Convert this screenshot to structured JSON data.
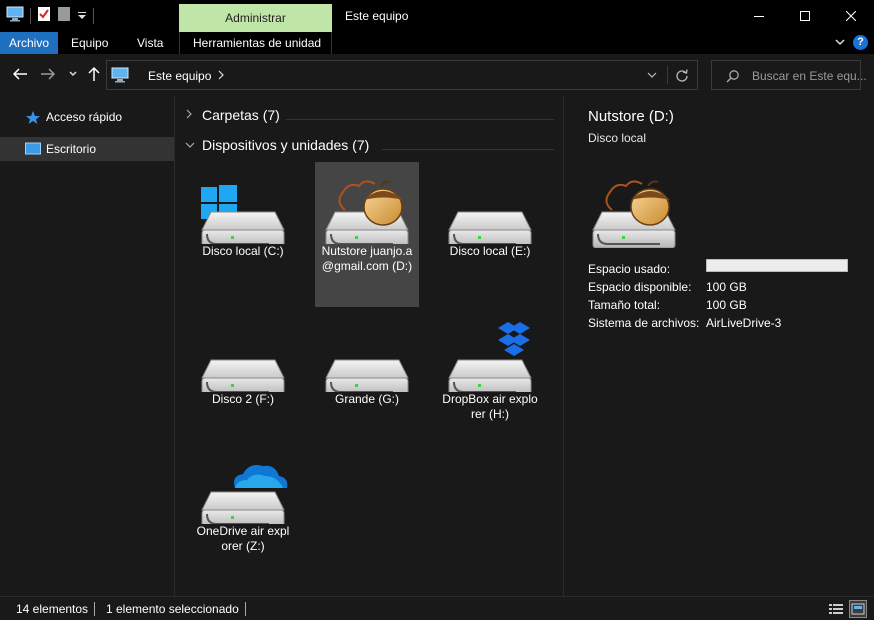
{
  "window": {
    "title": "Este equipo",
    "context_tab": "Administrar"
  },
  "ribbon": {
    "tabs": [
      "Archivo",
      "Equipo",
      "Vista"
    ],
    "context_tab_label": "Herramientas de unidad",
    "help": "?"
  },
  "address": {
    "breadcrumb": "Este equipo",
    "search_placeholder": "Buscar en Este equ..."
  },
  "sidebar": {
    "items": [
      {
        "label": "Acceso rápido",
        "icon": "star-icon"
      },
      {
        "label": "Escritorio",
        "icon": "desktop-icon"
      }
    ]
  },
  "groups": {
    "folders": {
      "label": "Carpetas (7)"
    },
    "devices": {
      "label": "Dispositivos y unidades (7)"
    }
  },
  "drives": [
    {
      "label": "Disco local (C:)",
      "icon": "windows-drive-icon"
    },
    {
      "label": "Nutstore juanjo.a@gmail.com (D:)",
      "icon": "nutstore-drive-icon",
      "selected": true
    },
    {
      "label": "Disco local (E:)",
      "icon": "drive-icon"
    },
    {
      "label": "Disco 2 (F:)",
      "icon": "drive-icon"
    },
    {
      "label": "Grande (G:)",
      "icon": "drive-icon"
    },
    {
      "label": "DropBox air explorer (H:)",
      "icon": "dropbox-drive-icon"
    },
    {
      "label": "OneDrive air explorer (Z:)",
      "icon": "onedrive-drive-icon"
    }
  ],
  "details": {
    "title": "Nutstore (D:)",
    "subtitle": "Disco local",
    "rows": [
      {
        "key": "Espacio usado:",
        "value": ""
      },
      {
        "key": "Espacio disponible:",
        "value": "100 GB"
      },
      {
        "key": "Tamaño total:",
        "value": "100 GB"
      },
      {
        "key": "Sistema de archivos:",
        "value": "AirLiveDrive-3"
      }
    ],
    "used_fraction": 0
  },
  "status": {
    "count": "14 elementos",
    "selected": "1 elemento seleccionado"
  },
  "colors": {
    "accent": "#1f6fc1",
    "context_tab": "#bfe6a6",
    "drive_led": "#3fd13f"
  }
}
